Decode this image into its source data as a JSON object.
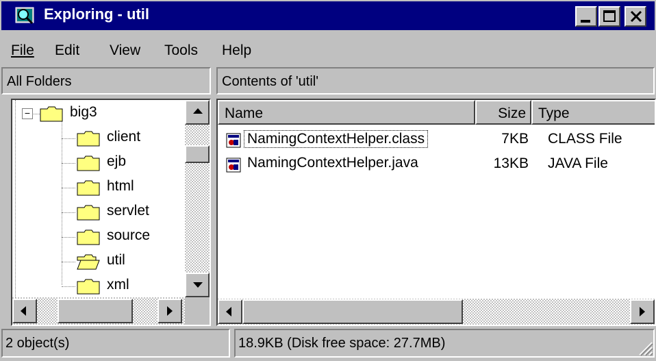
{
  "window": {
    "title": "Exploring - util",
    "app_icon": "explorer-magnifier-icon"
  },
  "menu": [
    {
      "label": "File"
    },
    {
      "label": "Edit"
    },
    {
      "label": "View"
    },
    {
      "label": "Tools"
    },
    {
      "label": "Help"
    }
  ],
  "left_header": "All Folders",
  "right_header": "Contents of 'util'",
  "tree": {
    "root": {
      "label": "big3",
      "expander": "−"
    },
    "children": [
      {
        "label": "client",
        "open": false
      },
      {
        "label": "ejb",
        "open": false
      },
      {
        "label": "html",
        "open": false
      },
      {
        "label": "servlet",
        "open": false
      },
      {
        "label": "source",
        "open": false
      },
      {
        "label": "util",
        "open": true
      },
      {
        "label": "xml",
        "open": false
      }
    ]
  },
  "columns": {
    "name": "Name",
    "size": "Size",
    "type": "Type"
  },
  "files": [
    {
      "name": "NamingContextHelper.class",
      "size": "7KB",
      "type": "CLASS File",
      "icon": "class-file-icon",
      "focused": true
    },
    {
      "name": "NamingContextHelper.java",
      "size": "13KB",
      "type": "JAVA File",
      "icon": "java-file-icon",
      "focused": false
    }
  ],
  "status": {
    "objects": "2 object(s)",
    "size": "18.9KB (Disk free space: 27.7MB)"
  },
  "colors": {
    "titlebar": "#000080",
    "face": "#c0c0c0",
    "folder": "#ffff80"
  }
}
